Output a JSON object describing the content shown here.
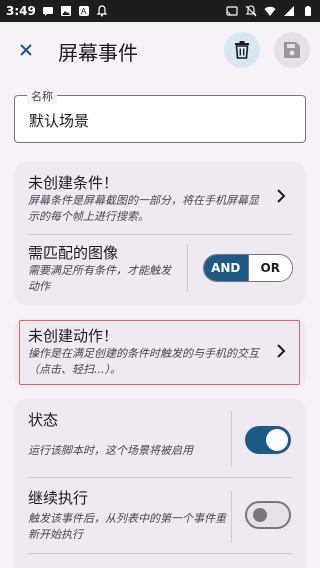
{
  "status_bar": {
    "time": "3:49",
    "left_icons": [
      "message-icon",
      "image-icon",
      "app-icon",
      "notification-icon"
    ],
    "right_icons": [
      "cast-icon",
      "mute-icon",
      "wifi-icon",
      "signal-icon",
      "battery-icon"
    ]
  },
  "top_bar": {
    "title": "屏幕事件",
    "close_icon": "close-icon",
    "delete_icon": "delete-icon",
    "save_icon": "save-icon"
  },
  "name_field": {
    "label": "名称",
    "value": "默认场景"
  },
  "conditions_card": {
    "title": "未创建条件！",
    "description": "屏幕条件是屏幕截图的一部分，将在手机屏幕显示的每个帧上进行搜索。",
    "match_title": "需匹配的图像",
    "match_description": "需要满足所有条件，才能触发动作",
    "operator_and": "AND",
    "operator_or": "OR",
    "operator_selected": "AND"
  },
  "actions_card": {
    "title": "未创建动作！",
    "description": "操作是在满足创建的条件时触发的与手机的交互（点击、轻扫...）。"
  },
  "settings_card": {
    "state_title": "状态",
    "state_description": "运行该脚本时，这个场景将被启用",
    "state_enabled": true,
    "continue_title": "继续执行",
    "continue_description": "触发该事件后，从列表中的第一个事件重新开始执行",
    "continue_enabled": false
  },
  "colors": {
    "accent": "#1c5b86",
    "highlight_border": "#e06565",
    "card_background": "#efe9f2",
    "screen_background": "#f7f2f8"
  }
}
